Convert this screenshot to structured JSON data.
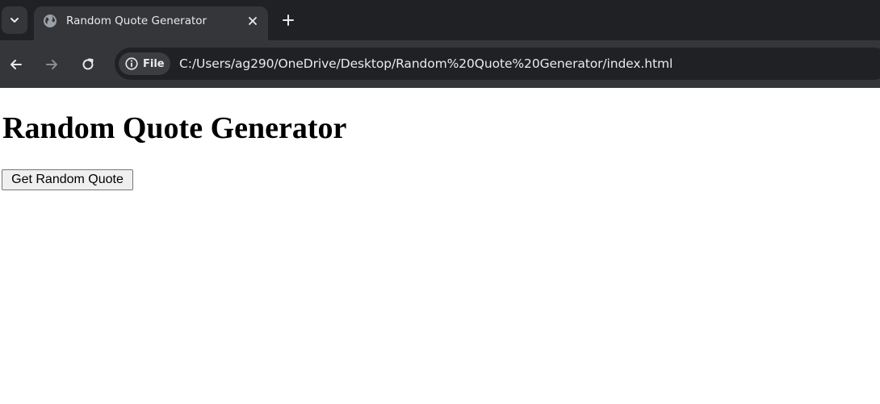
{
  "browser": {
    "tab": {
      "title": "Random Quote Generator"
    },
    "toolbar": {
      "site_info_label": "File",
      "url": "C:/Users/ag290/OneDrive/Desktop/Random%20Quote%20Generator/index.html"
    },
    "colors": {
      "tabstrip_bg": "#202124",
      "toolbar_bg": "#35363a",
      "omnibox_bg": "#202124",
      "text": "#e8eaed"
    }
  },
  "page": {
    "heading": "Random Quote Generator",
    "button_label": "Get Random Quote"
  }
}
